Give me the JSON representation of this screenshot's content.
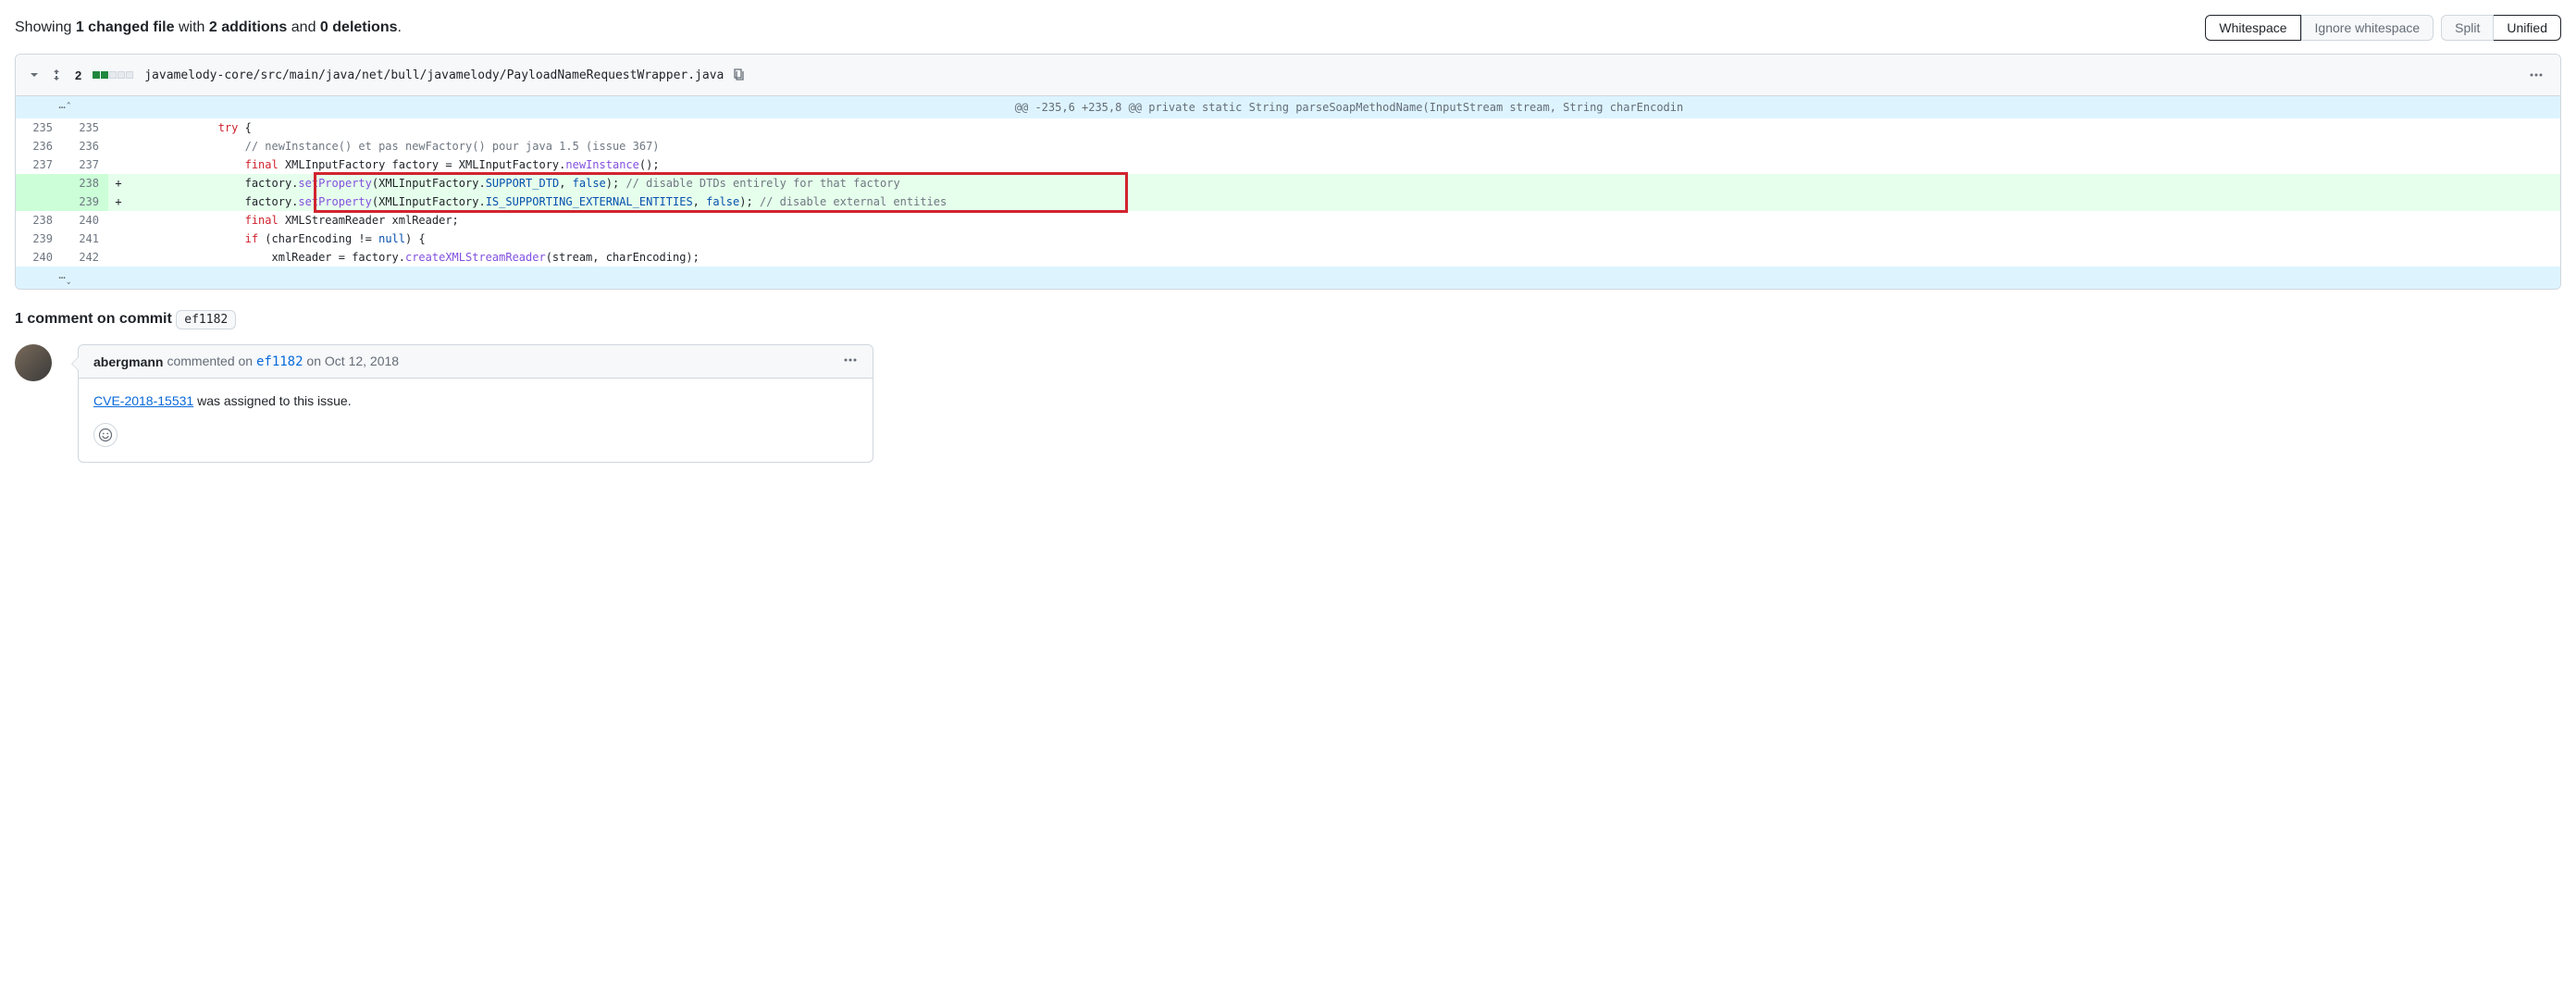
{
  "summary": {
    "prefix": "Showing ",
    "files_count": "1 changed file",
    "with": " with ",
    "additions": "2 additions",
    "and": " and ",
    "deletions": "0 deletions",
    "suffix": "."
  },
  "toolbar": {
    "whitespace_active": "Whitespace",
    "whitespace_ignore": "Ignore whitespace",
    "split": "Split",
    "unified": "Unified"
  },
  "file": {
    "change_count": "2",
    "diffstat_add": 2,
    "diffstat_total": 5,
    "path": "javamelody-core/src/main/java/net/bull/javamelody/PayloadNameRequestWrapper.java"
  },
  "hunk_header": "@@ -235,6 +235,8 @@ private static String parseSoapMethodName(InputStream stream, String charEncodin",
  "lines": [
    {
      "old": "235",
      "new": "235",
      "marker": "",
      "type": "ctx",
      "html": "\t\t\t<span class='pl-k'>try</span> {"
    },
    {
      "old": "236",
      "new": "236",
      "marker": "",
      "type": "ctx",
      "html": "\t\t\t\t<span class='pl-c'>// newInstance() et pas newFactory() pour java 1.5 (issue 367)</span>"
    },
    {
      "old": "237",
      "new": "237",
      "marker": "",
      "type": "ctx",
      "html": "\t\t\t\t<span class='pl-k'>final</span> XMLInputFactory factory = XMLInputFactory.<span class='pl-en'>newInstance</span>();"
    },
    {
      "old": "",
      "new": "238",
      "marker": "+",
      "type": "add",
      "html": "\t\t\t\tfactory.<span class='pl-en'>setProperty</span>(XMLInputFactory.<span class='pl-c1'>SUPPORT_DTD</span>, <span class='pl-c1'>false</span>); <span class='pl-c'>// disable DTDs entirely for that factory</span>"
    },
    {
      "old": "",
      "new": "239",
      "marker": "+",
      "type": "add",
      "html": "\t\t\t\tfactory.<span class='pl-en'>setProperty</span>(XMLInputFactory.<span class='pl-c1'>IS_SUPPORTING_EXTERNAL_ENTITIES</span>, <span class='pl-c1'>false</span>); <span class='pl-c'>// disable external entities</span>"
    },
    {
      "old": "238",
      "new": "240",
      "marker": "",
      "type": "ctx",
      "html": "\t\t\t\t<span class='pl-k'>final</span> XMLStreamReader xmlReader;"
    },
    {
      "old": "239",
      "new": "241",
      "marker": "",
      "type": "ctx",
      "html": "\t\t\t\t<span class='pl-k'>if</span> (charEncoding != <span class='pl-c1'>null</span>) {"
    },
    {
      "old": "240",
      "new": "242",
      "marker": "",
      "type": "ctx",
      "html": "\t\t\t\t\txmlReader = factory.<span class='pl-en'>createXMLStreamReader</span>(stream, charEncoding);"
    }
  ],
  "comments_heading": {
    "count_text": "1 comment on commit",
    "sha": "ef1182"
  },
  "comment": {
    "author": "abergmann",
    "action": " commented on ",
    "sha": "ef1182",
    "date": " on Oct 12, 2018",
    "body_link": "CVE-2018-15531",
    "body_rest": " was assigned to this issue."
  }
}
